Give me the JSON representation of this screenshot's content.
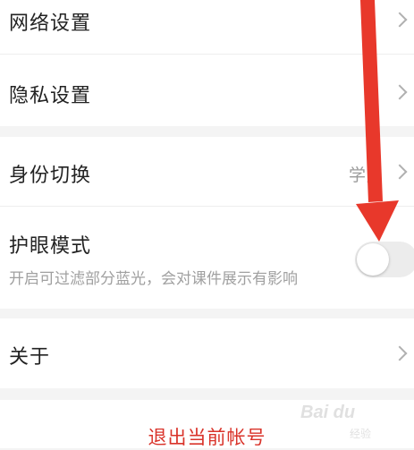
{
  "settings": {
    "group1": [
      {
        "label": "网络设置"
      },
      {
        "label": "隐私设置"
      }
    ],
    "identity": {
      "label": "身份切换",
      "value": "学员"
    },
    "eye_mode": {
      "label": "护眼模式",
      "description": "开启可过滤部分蓝光，会对课件展示有影响",
      "enabled": false
    },
    "about": {
      "label": "关于"
    }
  },
  "logout": {
    "label": "退出当前帐号"
  },
  "watermark": {
    "brand": "Bai du",
    "sub": "经验"
  },
  "colors": {
    "accent_red": "#d9332a",
    "arrow_red": "#e8382b",
    "background": "#f4f4f4"
  },
  "icons": {
    "chevron": "chevron-right-icon",
    "annotation": "red-arrow-annotation"
  }
}
